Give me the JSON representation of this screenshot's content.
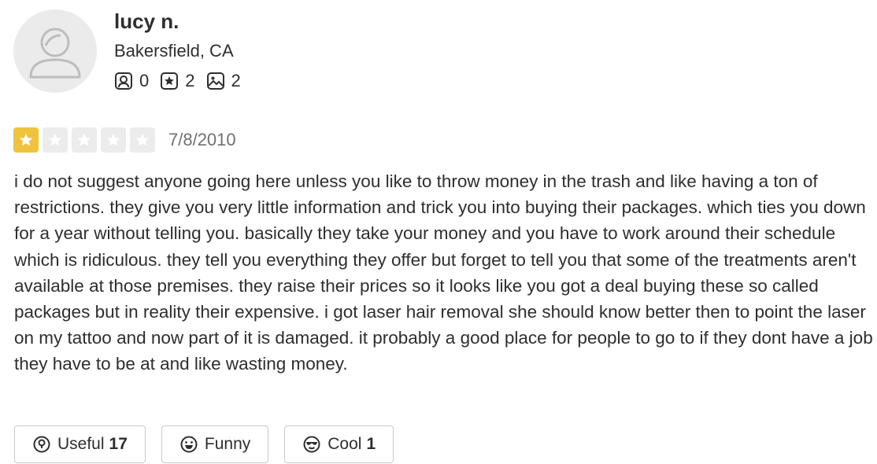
{
  "user": {
    "name": "lucy n.",
    "location": "Bakersfield, CA",
    "stats": {
      "friends": "0",
      "reviews": "2",
      "photos": "2"
    }
  },
  "review": {
    "rating": 1,
    "max_rating": 5,
    "date": "7/8/2010",
    "text": "i do not suggest anyone going here unless you like to throw money in the trash and like having a ton of restrictions. they give you very little information and trick you into buying their packages. which ties you down for a year without telling you. basically they take your money and you have to work around their schedule which is ridiculous. they tell you everything they offer but forget to tell you that some of the treatments aren't available at those premises. they raise their prices so it looks like you got a deal buying these so called packages but in reality their expensive. i got laser hair removal she should know better then to point the laser on my tattoo and now part of it is damaged. it probably a good place for people to go to if they dont have a job they have to be at and like wasting money."
  },
  "actions": {
    "useful": {
      "label": "Useful",
      "count": "17"
    },
    "funny": {
      "label": "Funny",
      "count": ""
    },
    "cool": {
      "label": "Cool",
      "count": "1"
    }
  },
  "colors": {
    "star_filled": "#f0c33c",
    "star_empty": "#ececec",
    "text": "#2d2e2f",
    "muted": "#6e7072"
  }
}
